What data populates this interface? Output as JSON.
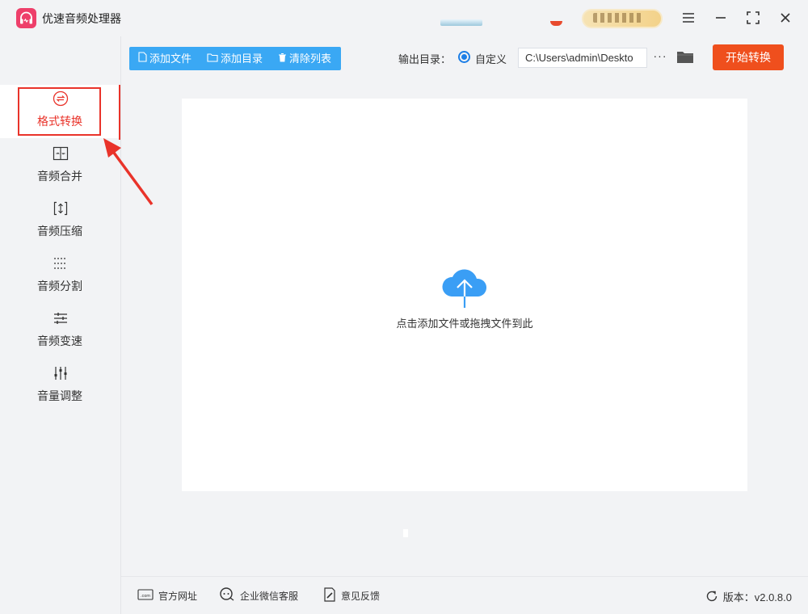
{
  "app": {
    "title": "优速音频处理器"
  },
  "sidebar": {
    "items": [
      {
        "id": "format",
        "label": "格式转换",
        "icon": "format-convert-icon",
        "active": true
      },
      {
        "id": "merge",
        "label": "音频合并",
        "icon": "merge-icon",
        "active": false
      },
      {
        "id": "compress",
        "label": "音频压缩",
        "icon": "compress-icon",
        "active": false
      },
      {
        "id": "split",
        "label": "音频分割",
        "icon": "split-icon",
        "active": false
      },
      {
        "id": "speed",
        "label": "音频变速",
        "icon": "speed-icon",
        "active": false
      },
      {
        "id": "volume",
        "label": "音量调整",
        "icon": "volume-icon",
        "active": false
      }
    ]
  },
  "toolbar": {
    "add_file": "添加文件",
    "add_dir": "添加目录",
    "clear_list": "清除列表",
    "output_label": "输出目录：",
    "radio_label": "自定义",
    "path_value": "C:\\Users\\admin\\Deskto",
    "more_label": "···",
    "start_label": "开始转换"
  },
  "dropzone": {
    "hint": "点击添加文件或拖拽文件到此"
  },
  "footer": {
    "website": "官方网址",
    "wechat": "企业微信客服",
    "feedback": "意见反馈",
    "version": "版本：v2.0.8.0"
  },
  "colors": {
    "accent_blue": "#3aa8f4",
    "accent_red": "#e9332a",
    "start_orange": "#ef4f1d",
    "cloud_blue": "#3a9ef5"
  }
}
